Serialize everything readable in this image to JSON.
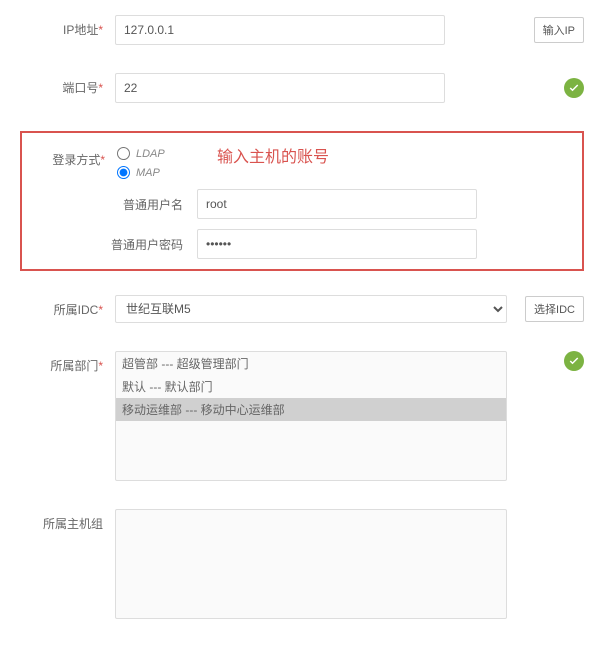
{
  "fields": {
    "ip": {
      "label": "IP地址",
      "value": "127.0.0.1",
      "button": "输入IP"
    },
    "port": {
      "label": "端口号",
      "value": "22"
    },
    "loginMethod": {
      "label": "登录方式",
      "options": {
        "ldap": "LDAP",
        "map": "MAP"
      },
      "selected": "map",
      "annotation": "输入主机的账号",
      "username": {
        "label": "普通用户名",
        "value": "root"
      },
      "password": {
        "label": "普通用户密码",
        "value": "••••••"
      }
    },
    "idc": {
      "label": "所属IDC",
      "value": "世纪互联M5",
      "button": "选择IDC"
    },
    "dept": {
      "label": "所属部门",
      "items": [
        {
          "text": "超管部 --- 超级管理部门",
          "selected": false
        },
        {
          "text": "默认 --- 默认部门",
          "selected": false
        },
        {
          "text": "移动运维部 --- 移动中心运维部",
          "selected": true
        }
      ]
    },
    "hostGroup": {
      "label": "所属主机组"
    }
  }
}
